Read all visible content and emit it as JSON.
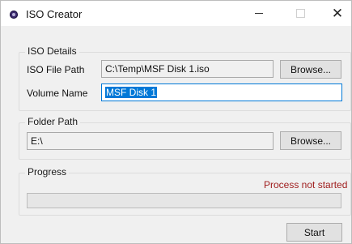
{
  "window": {
    "title": "ISO Creator",
    "controls": {
      "minimize": "—",
      "maximize": "☐",
      "close": "✕"
    }
  },
  "iso_details": {
    "group_label": "ISO Details",
    "file_path_label": "ISO File Path",
    "file_path_value": "C:\\Temp\\MSF Disk 1.iso",
    "browse_label": "Browse...",
    "volume_name_label": "Volume Name",
    "volume_name_value": "MSF Disk 1"
  },
  "folder_path": {
    "group_label": "Folder Path",
    "value": "E:\\",
    "browse_label": "Browse..."
  },
  "progress": {
    "group_label": "Progress",
    "status_text": "Process not started",
    "status_color": "#a02020",
    "percent": 0
  },
  "footer": {
    "start_label": "Start"
  }
}
